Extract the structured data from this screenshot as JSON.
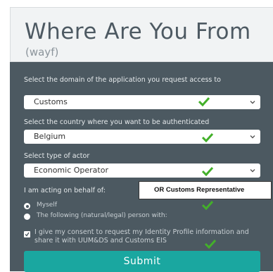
{
  "header": {
    "title": "Where Are You From",
    "subtitle": "(wayf)"
  },
  "domain_field": {
    "label": "Select the domain of the application you request access to",
    "value": "Customs"
  },
  "country_field": {
    "label": "Select the country where you want to be authenticated",
    "value": "Belgium"
  },
  "actor_field": {
    "label": "Select type of actor",
    "value": "Economic Operator"
  },
  "behalf": {
    "label": "I am acting on behalf of:",
    "options": [
      "Myself",
      "The following (natural/legal) person with:"
    ],
    "selected": "Myself"
  },
  "consent": {
    "text": "I give my consent to request my Identity Profile information and share it with UUM&DS and Customs EIS",
    "checked": true
  },
  "submit_label": "Submit",
  "callout": "OR Customs Representative",
  "colors": {
    "panel": "#4c5961",
    "submit": "#1aa7a0",
    "check": "#43b02a",
    "header_bg": "#f1f3f4"
  },
  "icons": {
    "check": "check-icon",
    "chevron": "chevron-down-icon"
  }
}
